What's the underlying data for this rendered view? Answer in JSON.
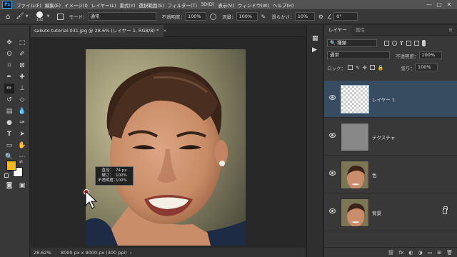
{
  "menubar": {
    "logo": "Ps",
    "items": [
      "ファイル(F)",
      "編集(E)",
      "イメージ(I)",
      "レイヤー(L)",
      "書式(Y)",
      "選択範囲(S)",
      "フィルター(T)",
      "3D(D)",
      "表示(V)",
      "ウィンドウ(W)",
      "ヘルプ(H)"
    ],
    "window_controls": [
      "—",
      "▢",
      "✕"
    ]
  },
  "options": {
    "brush_size": "102",
    "mode_label": "モード：",
    "mode_value": "通常",
    "opacity_label": "不透明度：",
    "opacity_value": "100%",
    "flow_label": "流量：",
    "flow_value": "100%",
    "smoothing_label": "滑らかさ：",
    "smoothing_value": "10%",
    "angle_value": "0°"
  },
  "document": {
    "tab_title": "sakuto tutorial-031.jpg @ 28.6% (レイヤー 1, RGB/8) *",
    "tab_close": "×",
    "zoom": "28.62%",
    "info": "8000 px x 9000 px (300 ppi)"
  },
  "brush_tooltip": {
    "rows": [
      {
        "label": "直径：",
        "value": "74 px"
      },
      {
        "label": "硬さ：",
        "value": "100%"
      },
      {
        "label": "不透明度：",
        "value": "100%"
      }
    ]
  },
  "colors": {
    "foreground": "#f4b820",
    "background": "#ffffff",
    "selected_layer": "#374b61",
    "cursor_dot": "#e02020"
  },
  "layers_panel": {
    "tabs": [
      "レイヤー",
      "属性"
    ],
    "filter_value": "種類",
    "blend_mode": "通常",
    "opacity_label": "不透明度：",
    "opacity_value": "100%",
    "lock_label": "ロック：",
    "fill_label": "塗り：",
    "fill_value": "100%",
    "layers": [
      {
        "name": "レイヤー 1",
        "selected": true,
        "thumb": "transparent"
      },
      {
        "name": "テクスチャ",
        "selected": false,
        "thumb": "gray"
      },
      {
        "name": "色",
        "selected": false,
        "thumb": "photo"
      },
      {
        "name": "背景",
        "selected": false,
        "thumb": "photo",
        "locked": true
      }
    ],
    "bottom_icons": [
      "link-icon",
      "fx",
      "mask-icon",
      "adjustment-icon",
      "folder-icon",
      "new-layer-icon",
      "trash-icon"
    ]
  }
}
